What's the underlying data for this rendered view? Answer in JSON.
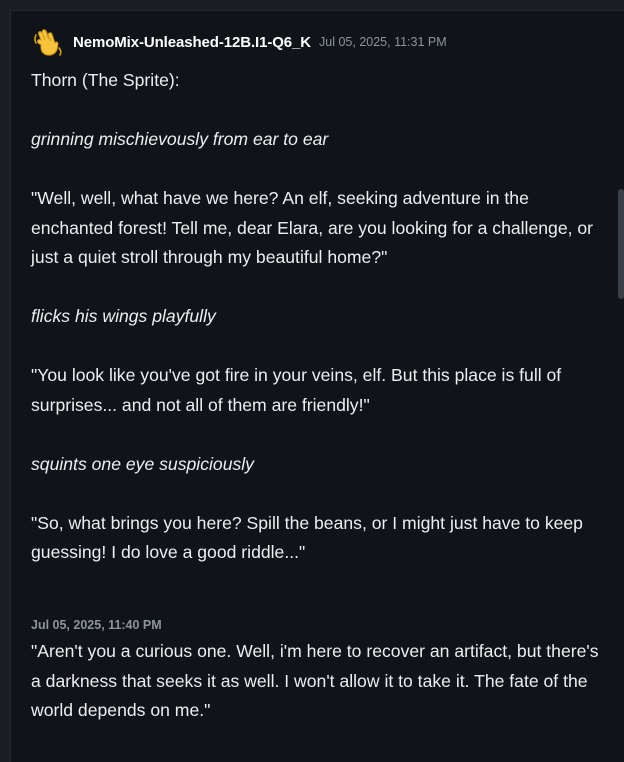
{
  "messages": [
    {
      "author": "NemoMix-Unleashed-12B.I1-Q6_K",
      "timestamp": "Jul 05, 2025, 11:31 PM",
      "avatar_icon": "waving-hand-icon",
      "paragraphs": [
        {
          "text": "Thorn (The Sprite):",
          "italic": false
        },
        {
          "text": "grinning mischievously from ear to ear",
          "italic": true
        },
        {
          "text": "\"Well, well, what have we here? An elf, seeking adventure in the enchanted forest! Tell me, dear Elara, are you looking for a challenge, or just a quiet stroll through my beautiful home?\"",
          "italic": false
        },
        {
          "text": "flicks his wings playfully",
          "italic": true
        },
        {
          "text": "\"You look like you've got fire in your veins, elf. But this place is full of surprises... and not all of them are friendly!\"",
          "italic": false
        },
        {
          "text": "squints one eye suspiciously",
          "italic": true
        },
        {
          "text": "\"So, what brings you here? Spill the beans, or I might just have to keep guessing! I do love a good riddle...\"",
          "italic": false
        }
      ]
    },
    {
      "timestamp": "Jul 05, 2025, 11:40 PM",
      "paragraphs": [
        {
          "text": "\"Aren't you a curious one. Well, i'm here to recover an artifact, but there's a darkness that seeks it as well. I won't allow it to take it. The fate of the world depends on me.\"",
          "italic": false
        }
      ]
    }
  ],
  "colors": {
    "background": "#101418",
    "text": "#eceff2",
    "muted": "#8c939d",
    "author": "#ffffff"
  }
}
